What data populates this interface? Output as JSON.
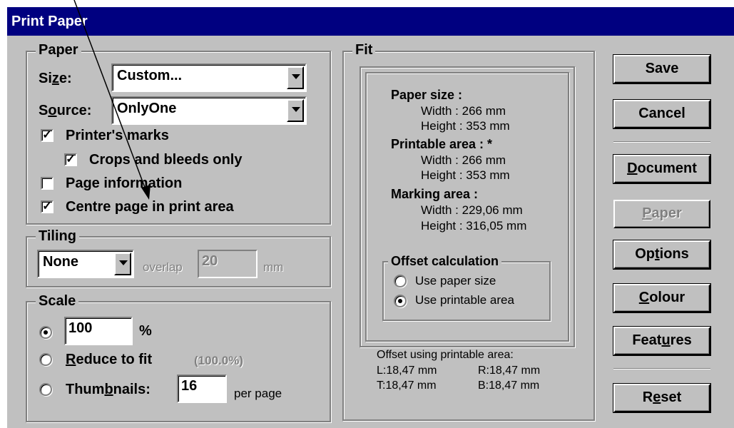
{
  "window": {
    "title": "Print Paper"
  },
  "paper": {
    "legend": "Paper",
    "size_label": "Size:",
    "size_value": "Custom...",
    "source_label": "Source:",
    "source_value": "OnlyOne",
    "printers_marks": {
      "label": "Printer's marks",
      "checked": true
    },
    "crops_bleeds": {
      "label": "Crops and bleeds only",
      "checked": true
    },
    "page_info": {
      "label": "Page information",
      "checked": false
    },
    "centre_page": {
      "label": "Centre page in print area",
      "checked": true
    }
  },
  "tiling": {
    "legend": "Tiling",
    "value": "None",
    "overlap_label": "overlap",
    "overlap_value": "20",
    "unit": "mm"
  },
  "scale": {
    "legend": "Scale",
    "percent_value": "100",
    "percent_unit": "%",
    "reduce_label": "Reduce to fit",
    "reduce_value": "(100.0%)",
    "thumbnails_label": "Thumbnails:",
    "thumbnails_value": "16",
    "per_page": "per page",
    "selected": "percent"
  },
  "fit": {
    "legend": "Fit",
    "paper_size_heading": "Paper size :",
    "paper_width": "Width : 266 mm",
    "paper_height": "Height : 353 mm",
    "printable_heading": "Printable area : *",
    "printable_width": "Width : 266 mm",
    "printable_height": "Height : 353 mm",
    "marking_heading": "Marking area :",
    "marking_width": "Width : 229,06 mm",
    "marking_height": "Height : 316,05 mm",
    "offset_legend": "Offset calculation",
    "use_paper_size": "Use paper size",
    "use_printable_area": "Use printable area",
    "offset_selected": "printable",
    "offset_caption": "Offset using printable area:",
    "left": "L:18,47 mm",
    "right": "R:18,47 mm",
    "top": "T:18,47 mm",
    "bottom": "B:18,47 mm"
  },
  "buttons": {
    "save": "Save",
    "cancel": "Cancel",
    "document": "Document",
    "paper": "Paper",
    "options": "Options",
    "colour": "Colour",
    "features": "Features",
    "reset": "Reset"
  },
  "colors": {
    "titlebar": "#000080",
    "face": "#c0c0c0",
    "disabled_text": "#808080"
  }
}
